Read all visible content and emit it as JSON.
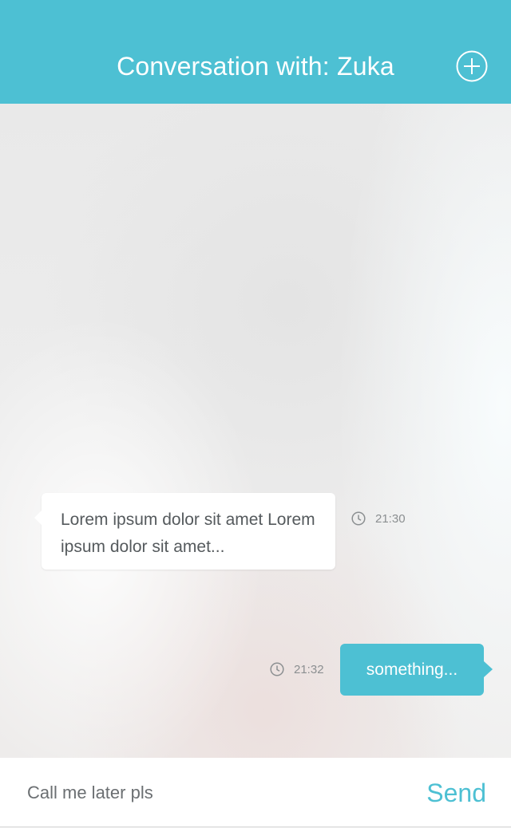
{
  "header": {
    "title": "Conversation with: Zuka",
    "add_icon": "plus-circle-icon",
    "background_color": "#4dc0d3"
  },
  "messages": [
    {
      "direction": "incoming",
      "text": "Lorem ipsum dolor sit amet Lorem ipsum dolor sit amet...",
      "time": "21:30",
      "time_icon": "clock-icon"
    },
    {
      "direction": "outgoing",
      "text": "something...",
      "time": "21:32",
      "time_icon": "clock-icon"
    }
  ],
  "composer": {
    "input_value": "Call me later pls",
    "send_label": "Send",
    "accent_color": "#4dc0d3"
  }
}
